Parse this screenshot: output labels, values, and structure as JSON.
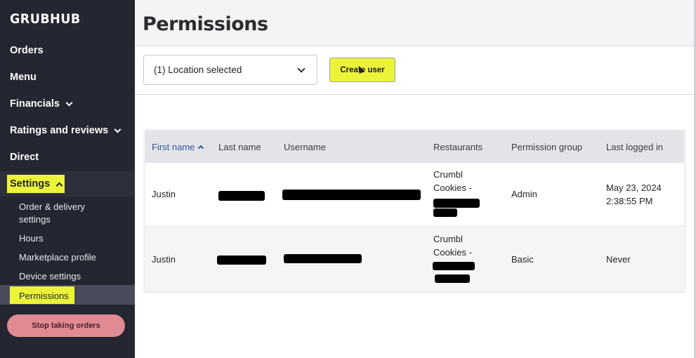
{
  "brand": {
    "logo": "GRUBHUB",
    "accent": "#ecf43a",
    "sidebar_bg": "#242632"
  },
  "sidebar": {
    "items": [
      {
        "label": "Orders"
      },
      {
        "label": "Menu"
      },
      {
        "label": "Financials"
      },
      {
        "label": "Ratings and reviews"
      },
      {
        "label": "Direct"
      },
      {
        "label": "Settings"
      }
    ],
    "settings_sub": [
      {
        "label": "Order & delivery settings"
      },
      {
        "label": "Hours"
      },
      {
        "label": "Marketplace profile"
      },
      {
        "label": "Device settings"
      },
      {
        "label": "Permissions"
      }
    ],
    "stop_button": "Stop taking orders"
  },
  "page": {
    "title": "Permissions",
    "location_select": "(1) Location selected",
    "create_user": "Create user"
  },
  "table": {
    "headers": [
      "First name",
      "Last name",
      "Username",
      "Restaurants",
      "Permission group",
      "Last logged in"
    ],
    "rows": [
      {
        "first_name": "Justin",
        "restaurant_l1": "Crumbl",
        "restaurant_l2": "Cookies -",
        "permission_group": "Admin",
        "last_login_l1": "May 23, 2024",
        "last_login_l2": "2:38:55 PM"
      },
      {
        "first_name": "Justin",
        "restaurant_l1": "Crumbl",
        "restaurant_l2": "Cookies -",
        "permission_group": "Basic",
        "last_login_l1": "Never",
        "last_login_l2": ""
      }
    ]
  }
}
